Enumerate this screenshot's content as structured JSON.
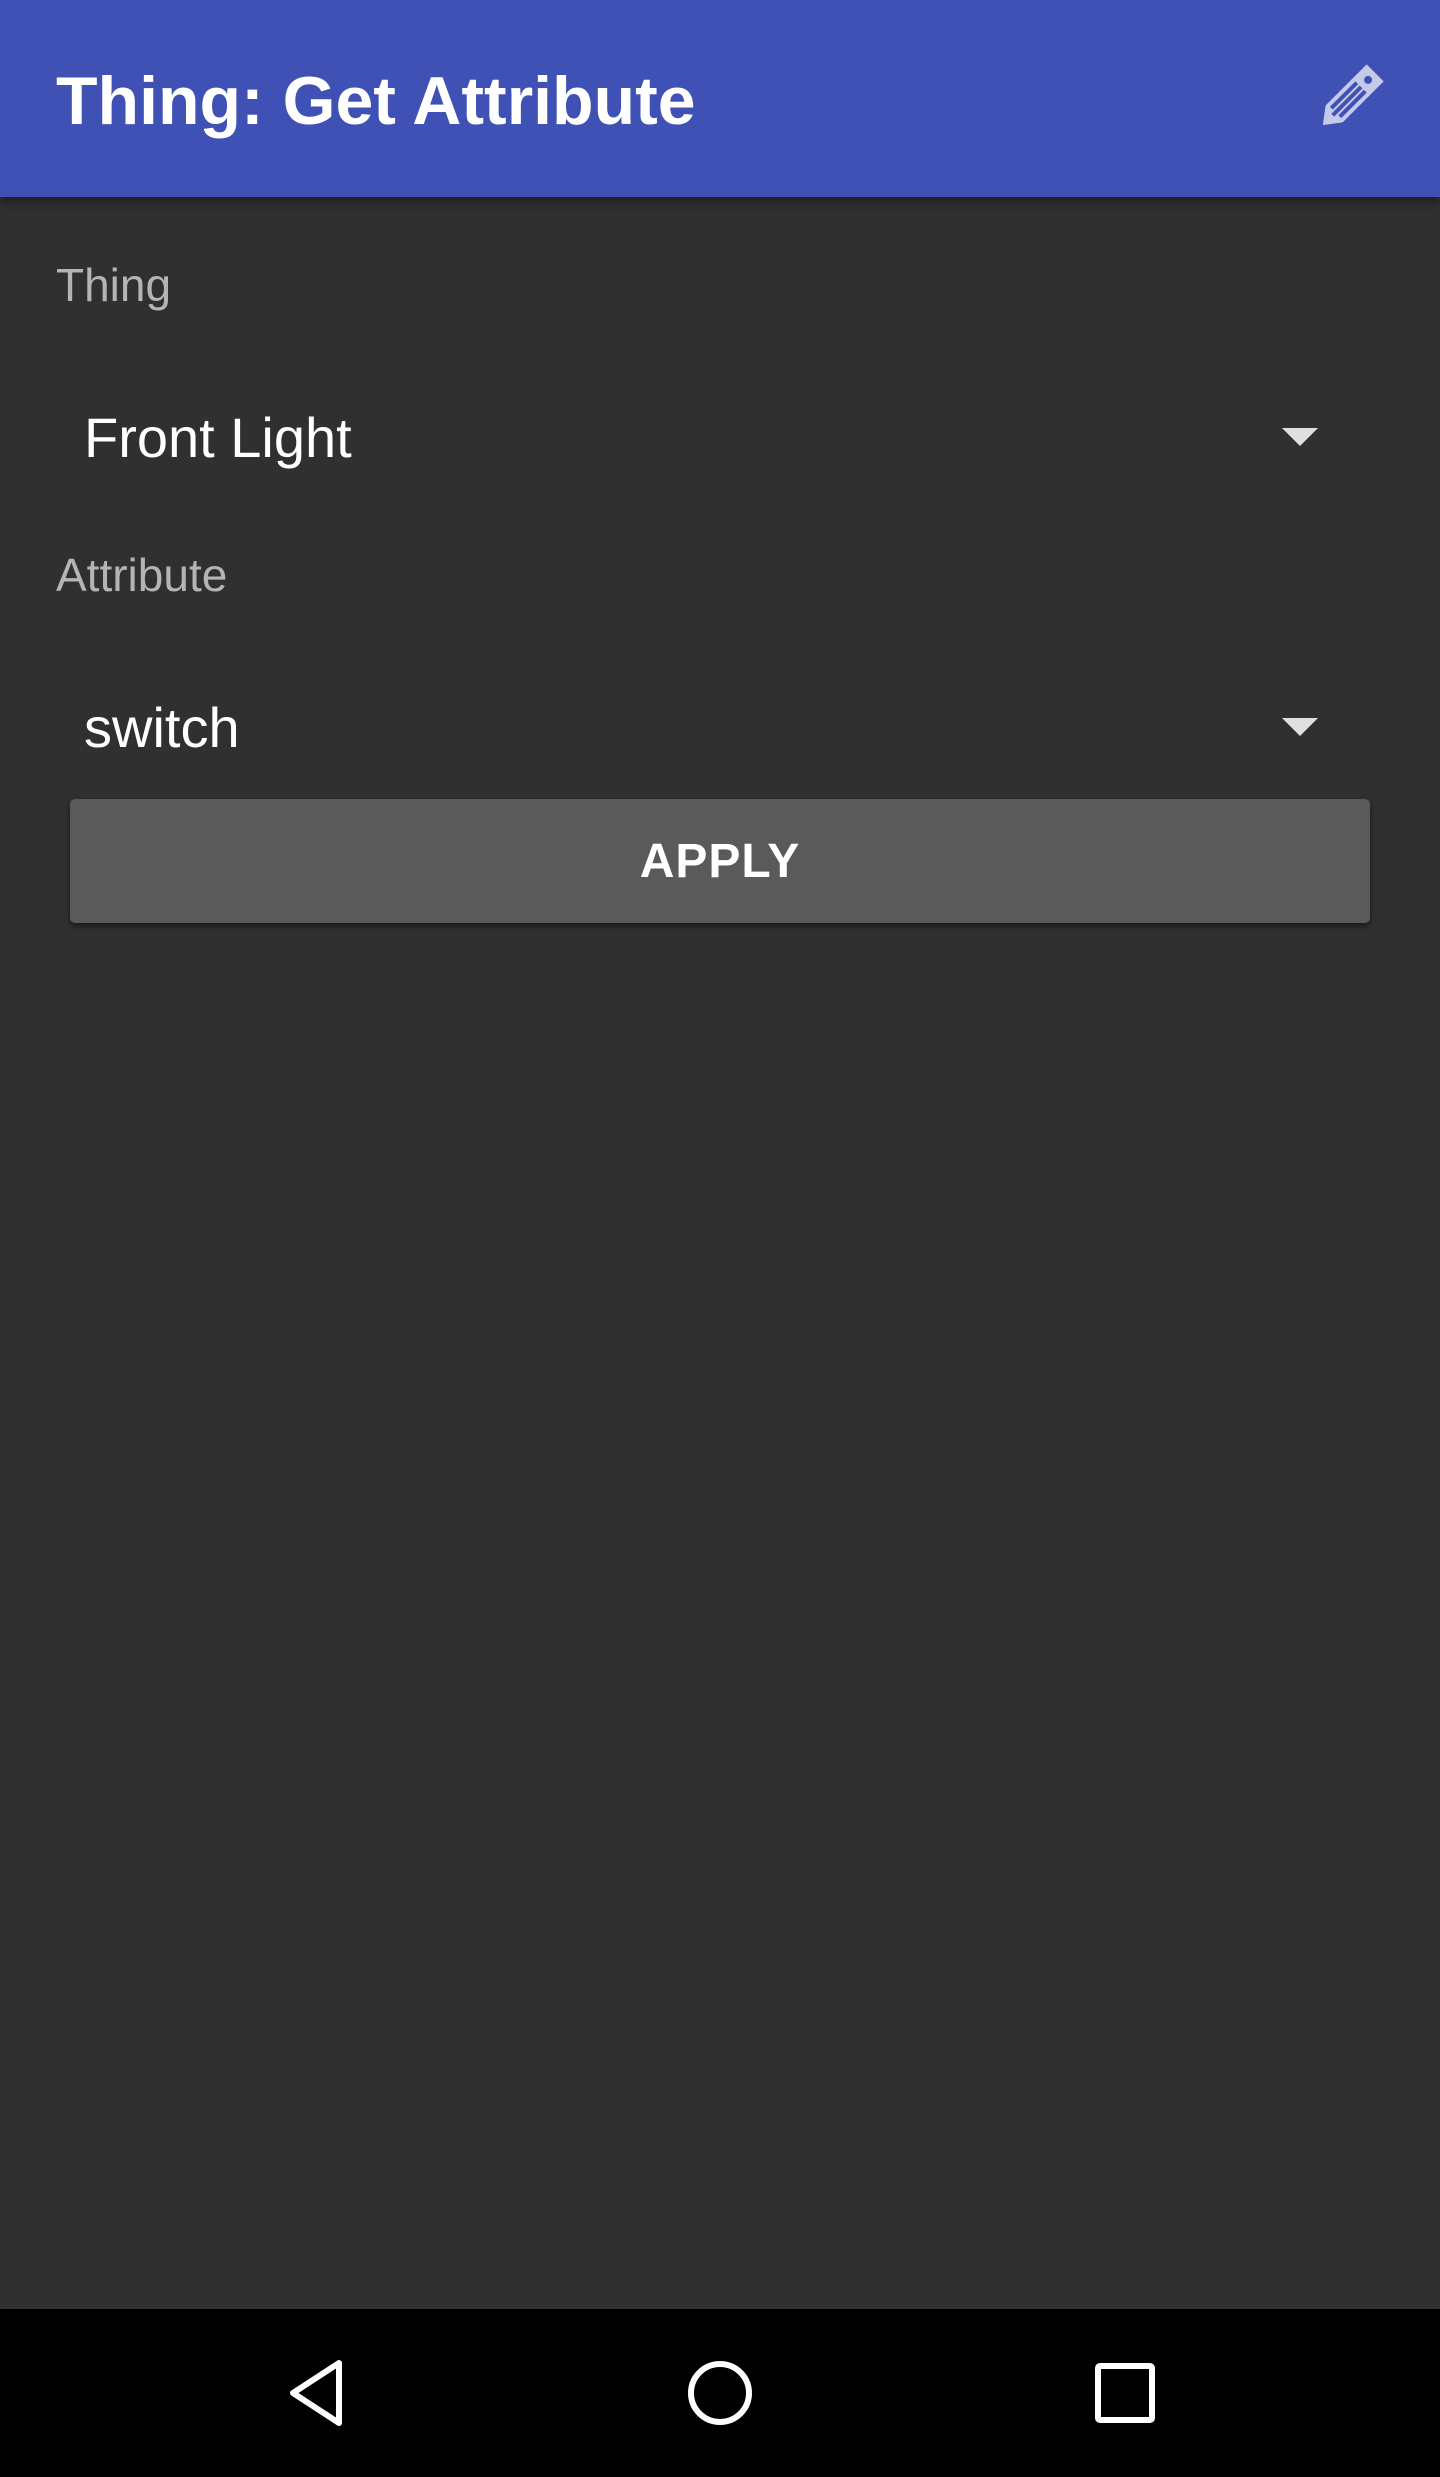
{
  "app_bar": {
    "title": "Thing: Get Attribute",
    "action_icon": "edit-tag-icon",
    "background_color": "#3f51b5"
  },
  "form": {
    "thing": {
      "label": "Thing",
      "selected_value": "Front Light"
    },
    "attribute": {
      "label": "Attribute",
      "selected_value": "switch"
    },
    "apply_button_label": "APPLY"
  },
  "nav_bar": {
    "back_icon": "back-icon",
    "home_icon": "home-icon",
    "recents_icon": "recents-icon"
  },
  "colors": {
    "background": "#303030",
    "label_text": "#b4b4b4",
    "button_background": "#5a5a5a"
  }
}
